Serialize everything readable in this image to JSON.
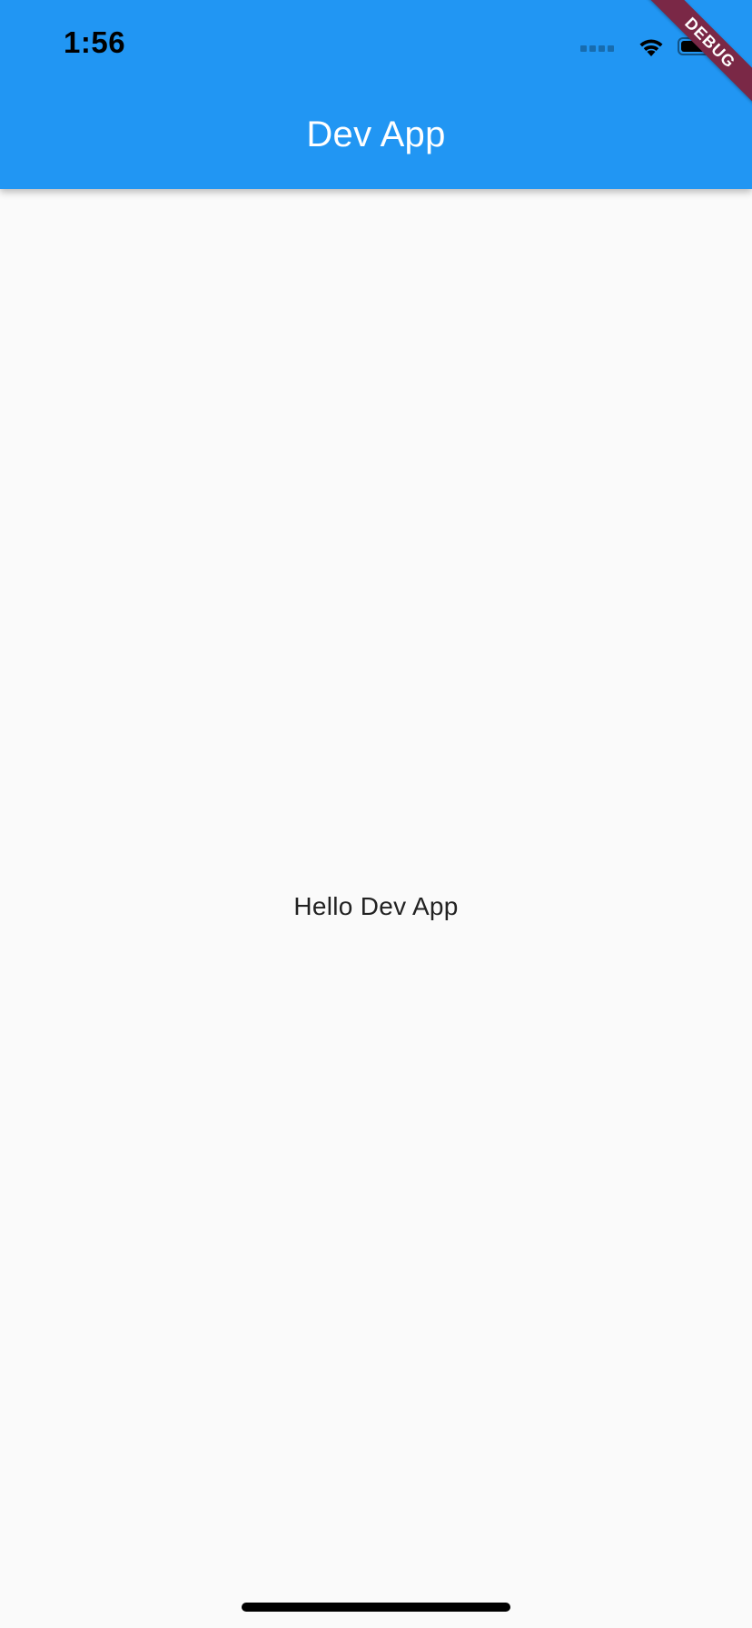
{
  "status_bar": {
    "time": "1:56",
    "signal_icon": "cellular-signal-icon",
    "wifi_icon": "wifi-icon",
    "battery_icon": "battery-icon",
    "battery_level": 1.0
  },
  "app_bar": {
    "title": "Dev App",
    "color": "#2196f3"
  },
  "body": {
    "text": "Hello Dev App",
    "background": "#fafafa"
  },
  "debug_banner": {
    "label": "DEBUG",
    "color": "#7a2846"
  }
}
